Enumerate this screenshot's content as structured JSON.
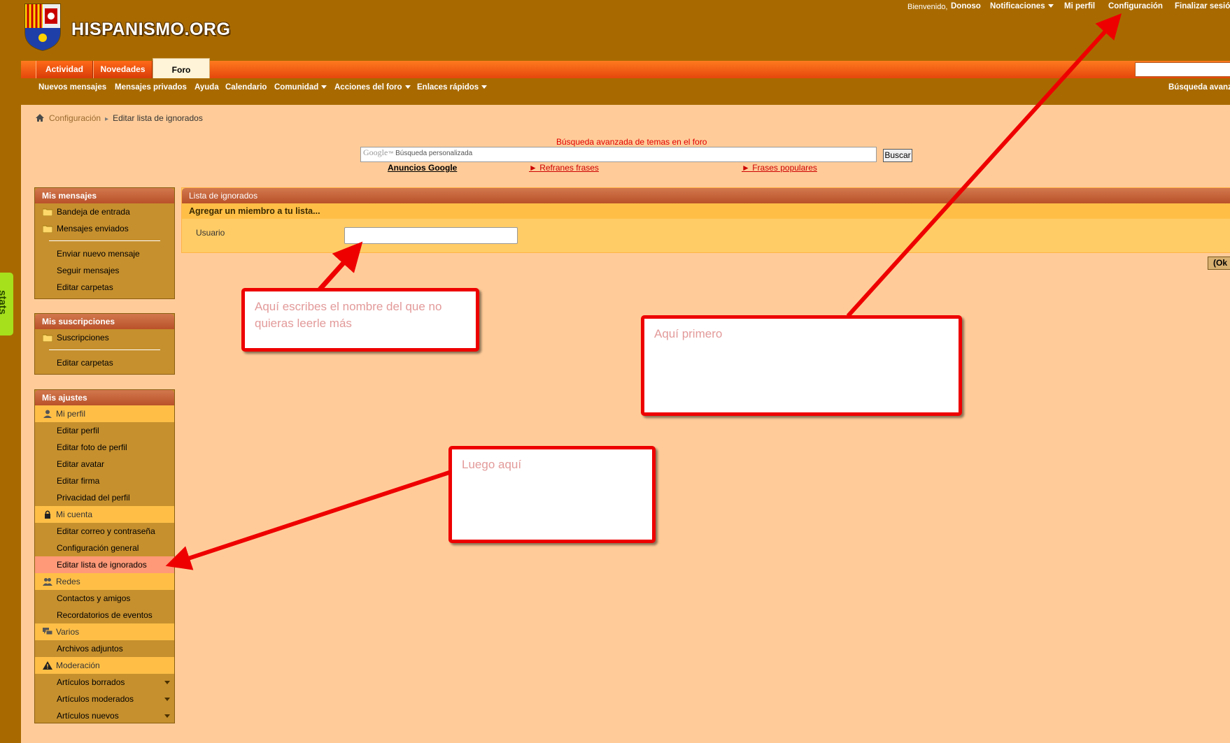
{
  "header": {
    "site_name": "HISPANISMO.ORG",
    "welcome": "Bienvenido,",
    "username": "Donoso",
    "notifications": "Notificaciones",
    "my_profile": "Mi perfil",
    "settings": "Configuración",
    "logout": "Finalizar sesió"
  },
  "tabs": [
    "Actividad",
    "Novedades",
    "Foro"
  ],
  "subnav": [
    "Nuevos mensajes",
    "Mensajes privados",
    "Ayuda",
    "Calendario",
    "Comunidad",
    "Acciones del foro",
    "Enlaces rápidos",
    "Búsqueda avanz"
  ],
  "breadcrumb": {
    "home": "home-icon",
    "link": "Configuración",
    "current": "Editar lista de ignorados"
  },
  "google_search": {
    "title": "Búsqueda avanzada de temas en el foro",
    "logo": "Google",
    "placeholder": "Búsqueda personalizada",
    "button": "Buscar",
    "ads": "Anuncios Google",
    "link1": "► Refranes frases",
    "link2": "► Frases populares"
  },
  "sidebar": {
    "messages": {
      "title": "Mis mensajes",
      "inbox": "Bandeja de entrada",
      "sent": "Mensajes enviados",
      "new": "Enviar nuevo mensaje",
      "track": "Seguir mensajes",
      "folders": "Editar carpetas"
    },
    "subscriptions": {
      "title": "Mis suscripciones",
      "subs": "Suscripciones",
      "folders": "Editar carpetas"
    },
    "settings": {
      "title": "Mis ajustes",
      "profile_cat": "Mi perfil",
      "edit_profile": "Editar perfil",
      "edit_photo": "Editar foto de perfil",
      "edit_avatar": "Editar avatar",
      "edit_signature": "Editar firma",
      "privacy": "Privacidad del perfil",
      "account_cat": "Mi cuenta",
      "email_pass": "Editar correo y contraseña",
      "general": "Configuración general",
      "ignore_list": "Editar lista de ignorados",
      "networks_cat": "Redes",
      "contacts": "Contactos y amigos",
      "reminders": "Recordatorios de eventos",
      "misc_cat": "Varios",
      "attachments": "Archivos adjuntos",
      "moderation_cat": "Moderación",
      "deleted": "Artículos borrados",
      "moderated": "Artículos moderados",
      "newposts": "Artículos nuevos"
    }
  },
  "ignore_list": {
    "title": "Lista de ignorados",
    "subtitle": "Agregar un miembro a tu lista...",
    "user_label": "Usuario",
    "user_value": "",
    "ok": "(Ok"
  },
  "stats_tab": "stats",
  "callouts": {
    "name_hint": "Aquí escribes el nombre del que no quieras leerle más",
    "first": "Aquí primero",
    "then": "Luego aquí"
  },
  "colors": {
    "annotation_red": "#ee0000",
    "tab_orange": "#f25a14",
    "page_bg": "#ffcc99",
    "frame": "#a86a00"
  }
}
